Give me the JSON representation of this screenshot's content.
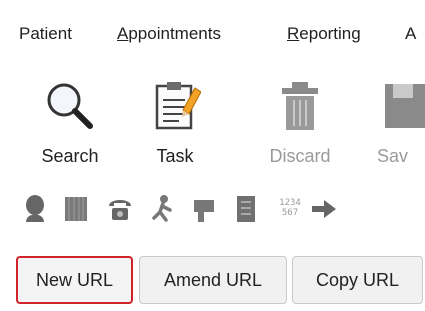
{
  "menu": {
    "items": [
      {
        "label": "Patient",
        "underline": ""
      },
      {
        "label": "ppointments",
        "underline": "A"
      },
      {
        "label": "eporting",
        "underline": "R"
      },
      {
        "label": "A",
        "underline": ""
      }
    ]
  },
  "toolbar": {
    "buttons": [
      {
        "label": "Search",
        "icon": "search-icon",
        "enabled": true
      },
      {
        "label": "Task",
        "icon": "task-icon",
        "enabled": true
      },
      {
        "label": "Discard",
        "icon": "trash-icon",
        "enabled": false
      },
      {
        "label": "Sav",
        "icon": "save-icon",
        "enabled": false
      }
    ]
  },
  "icon_row": {
    "icons": [
      "person-icon",
      "barcode-icon",
      "phone-icon",
      "stick-figure-icon",
      "flag-icon",
      "document-icon",
      "number-pad-icon",
      "arrow-right-icon"
    ],
    "number_pad_text": "1234 567"
  },
  "tabs": {
    "items": [
      "New URL",
      "Amend URL",
      "Copy URL"
    ],
    "active_index": 0
  },
  "colors": {
    "active_border": "#d0232a",
    "icon_dark": "#4a4a4a",
    "icon_gray": "#8a8a8a"
  }
}
